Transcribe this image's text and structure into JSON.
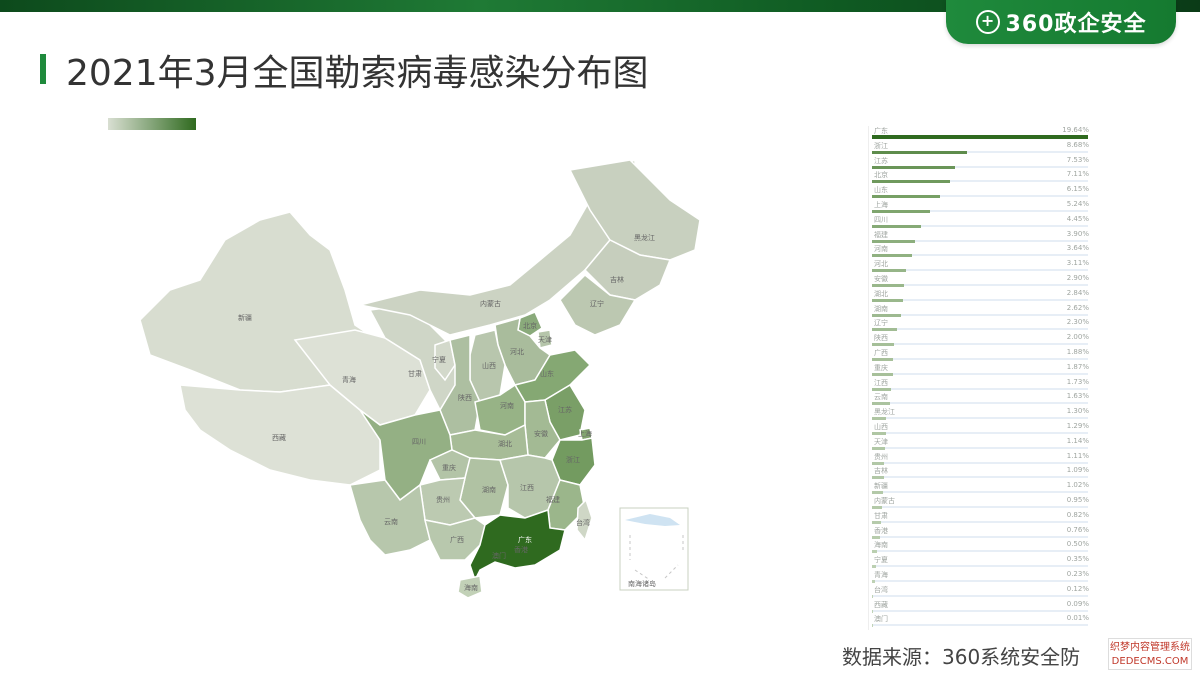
{
  "header": {
    "logo_text": "360政企安全"
  },
  "title": "2021年3月全国勒索病毒感染分布图",
  "map": {
    "provinces": {
      "xinjiang": "新疆",
      "xizang": "西藏",
      "qinghai": "青海",
      "gansu": "甘肃",
      "neimenggu": "内蒙古",
      "heilongjiang": "黑龙江",
      "jilin": "吉林",
      "liaoning": "辽宁",
      "beijing": "北京",
      "tianjin": "天津",
      "hebei": "河北",
      "shanxi": "山西",
      "ningxia": "宁夏",
      "shaanxi": "陕西",
      "shandong": "山东",
      "henan": "河南",
      "jiangsu": "江苏",
      "shanghai": "上海",
      "anhui": "安徽",
      "hubei": "湖北",
      "sichuan": "四川",
      "chongqing": "重庆",
      "zhejiang": "浙江",
      "hunan": "湖南",
      "jiangxi": "江西",
      "guizhou": "贵州",
      "fujian": "福建",
      "yunnan": "云南",
      "guangxi": "广西",
      "guangdong": "广东",
      "taiwan": "台湾",
      "xianggang": "香港",
      "aomen": "澳门",
      "hainan": "海南"
    },
    "inset_label": "南海诸岛"
  },
  "ranking": [
    {
      "label": "广东",
      "value": "19.64%",
      "pct": 19.64,
      "color": "#2f6a1f"
    },
    {
      "label": "浙江",
      "value": "8.68%",
      "pct": 8.68,
      "color": "#5e8c4c"
    },
    {
      "label": "江苏",
      "value": "7.53%",
      "pct": 7.53,
      "color": "#6a9558"
    },
    {
      "label": "北京",
      "value": "7.11%",
      "pct": 7.11,
      "color": "#6f995d"
    },
    {
      "label": "山东",
      "value": "6.15%",
      "pct": 6.15,
      "color": "#77a065"
    },
    {
      "label": "上海",
      "value": "5.24%",
      "pct": 5.24,
      "color": "#7fa56e"
    },
    {
      "label": "四川",
      "value": "4.45%",
      "pct": 4.45,
      "color": "#86aa76"
    },
    {
      "label": "福建",
      "value": "3.90%",
      "pct": 3.9,
      "color": "#8cae7d"
    },
    {
      "label": "河南",
      "value": "3.64%",
      "pct": 3.64,
      "color": "#90b181"
    },
    {
      "label": "河北",
      "value": "3.11%",
      "pct": 3.11,
      "color": "#96b588"
    },
    {
      "label": "安徽",
      "value": "2.90%",
      "pct": 2.9,
      "color": "#99b78b"
    },
    {
      "label": "湖北",
      "value": "2.84%",
      "pct": 2.84,
      "color": "#9ab88c"
    },
    {
      "label": "湖南",
      "value": "2.62%",
      "pct": 2.62,
      "color": "#9db990"
    },
    {
      "label": "辽宁",
      "value": "2.30%",
      "pct": 2.3,
      "color": "#a1bc94"
    },
    {
      "label": "陕西",
      "value": "2.00%",
      "pct": 2.0,
      "color": "#a5bf98"
    },
    {
      "label": "广西",
      "value": "1.88%",
      "pct": 1.88,
      "color": "#a7c09a"
    },
    {
      "label": "重庆",
      "value": "1.87%",
      "pct": 1.87,
      "color": "#a7c09a"
    },
    {
      "label": "江西",
      "value": "1.73%",
      "pct": 1.73,
      "color": "#a9c29d"
    },
    {
      "label": "云南",
      "value": "1.63%",
      "pct": 1.63,
      "color": "#abc39f"
    },
    {
      "label": "黑龙江",
      "value": "1.30%",
      "pct": 1.3,
      "color": "#afc6a3"
    },
    {
      "label": "山西",
      "value": "1.29%",
      "pct": 1.29,
      "color": "#afc6a3"
    },
    {
      "label": "天津",
      "value": "1.14%",
      "pct": 1.14,
      "color": "#b1c8a6"
    },
    {
      "label": "贵州",
      "value": "1.11%",
      "pct": 1.11,
      "color": "#b2c8a7"
    },
    {
      "label": "吉林",
      "value": "1.09%",
      "pct": 1.09,
      "color": "#b2c8a7"
    },
    {
      "label": "新疆",
      "value": "1.02%",
      "pct": 1.02,
      "color": "#b3c9a8"
    },
    {
      "label": "内蒙古",
      "value": "0.95%",
      "pct": 0.95,
      "color": "#b4caa9"
    },
    {
      "label": "甘肃",
      "value": "0.82%",
      "pct": 0.82,
      "color": "#b6cbab"
    },
    {
      "label": "香港",
      "value": "0.76%",
      "pct": 0.76,
      "color": "#b7ccac"
    },
    {
      "label": "海南",
      "value": "0.50%",
      "pct": 0.5,
      "color": "#bacfb0"
    },
    {
      "label": "宁夏",
      "value": "0.35%",
      "pct": 0.35,
      "color": "#bcd0b2"
    },
    {
      "label": "青海",
      "value": "0.23%",
      "pct": 0.23,
      "color": "#bed1b4"
    },
    {
      "label": "台湾",
      "value": "0.12%",
      "pct": 0.12,
      "color": "#c0d3b6"
    },
    {
      "label": "西藏",
      "value": "0.09%",
      "pct": 0.09,
      "color": "#c0d3b6"
    },
    {
      "label": "澳门",
      "value": "0.01%",
      "pct": 0.01,
      "color": "#c1d4b7"
    }
  ],
  "source": "数据来源：360系统安全防",
  "watermark": "织梦内容管理系统 DEDECMS.COM"
}
